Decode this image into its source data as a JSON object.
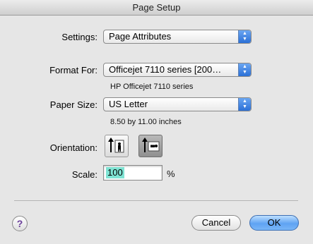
{
  "window": {
    "title": "Page Setup"
  },
  "settings": {
    "label": "Settings:",
    "value": "Page Attributes"
  },
  "format_for": {
    "label": "Format For:",
    "value": "Officejet 7110 series [200…",
    "description": "HP Officejet 7110 series"
  },
  "paper_size": {
    "label": "Paper Size:",
    "value": "US Letter",
    "description": "8.50 by 11.00 inches"
  },
  "orientation": {
    "label": "Orientation:",
    "options": [
      "portrait",
      "landscape"
    ],
    "selected": "landscape"
  },
  "scale": {
    "label": "Scale:",
    "value": "100",
    "unit": "%"
  },
  "buttons": {
    "help": "?",
    "cancel": "Cancel",
    "ok": "OK"
  },
  "colors": {
    "accent": "#2b6fd6",
    "selection": "#7fe3d3"
  },
  "icons": {
    "popup_arrows": "up-down-arrows-icon",
    "portrait": "portrait-orientation-icon",
    "landscape": "landscape-orientation-icon",
    "help": "help-icon"
  }
}
